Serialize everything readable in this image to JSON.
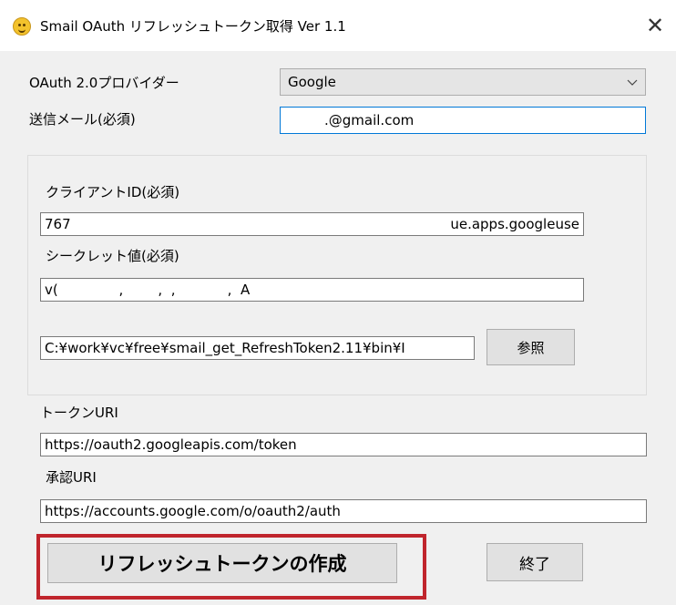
{
  "window": {
    "title": "Smail OAuth リフレッシュトークン取得 Ver 1.1",
    "close_label": "✕"
  },
  "provider": {
    "label": "OAuth 2.0プロバイダー",
    "selected": "Google"
  },
  "email": {
    "label": "送信メール(必須)",
    "value": ".@gmail.com"
  },
  "client_id": {
    "label": "クライアントID(必須)",
    "value_start": "767",
    "value_end": "ue.apps.googleuse"
  },
  "secret": {
    "label": "シークレット値(必須)",
    "value": "v(              ,        ,  ,            ,  A"
  },
  "file": {
    "path": "C:¥work¥vc¥free¥smail_get_RefreshToken2.11¥bin¥I",
    "browse_label": "参照"
  },
  "token_uri": {
    "label": "トークンURI",
    "value": "https://oauth2.googleapis.com/token"
  },
  "auth_uri": {
    "label": "承認URI",
    "value": "https://accounts.google.com/o/oauth2/auth"
  },
  "buttons": {
    "create_label": "リフレッシュトークンの作成",
    "exit_label": "終了"
  },
  "colors": {
    "accent_focus": "#0078d7",
    "highlight": "#c0252c"
  }
}
